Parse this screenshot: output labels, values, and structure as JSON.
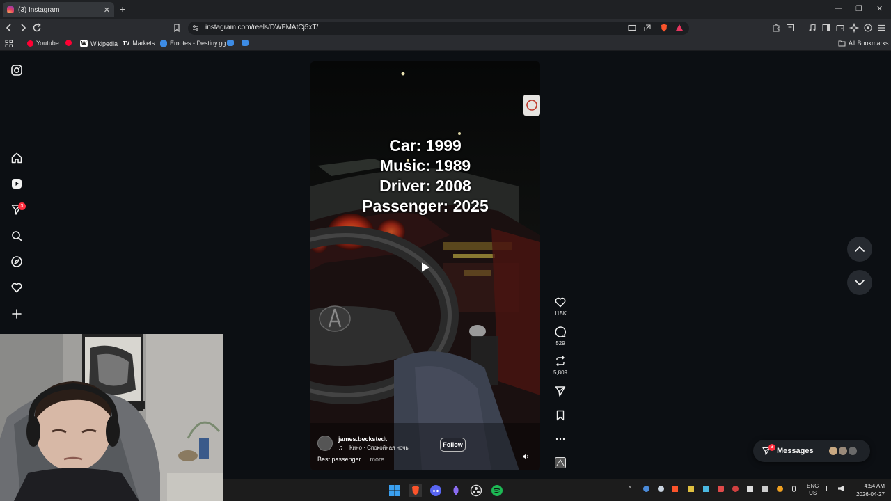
{
  "browser": {
    "tab_title": "(3) Instagram",
    "tab_close": "✕",
    "new_tab": "+",
    "url": "instagram.com/reels/DWFMAtCj5xT/",
    "window_controls": {
      "minimize": "—",
      "restore": "❐",
      "close": "✕"
    }
  },
  "bookmarks": {
    "items": [
      {
        "label": "Youtube",
        "icon": "youtube-icon",
        "color": "#ff0033"
      },
      {
        "label": "",
        "icon": "youtube-icon",
        "color": "#ff0033"
      },
      {
        "label": "Wikipedia",
        "icon": "wikipedia-icon",
        "color": "#ffffff"
      },
      {
        "label": "Markets",
        "icon": "tradingview-icon",
        "color": "#ffffff"
      },
      {
        "label": "Emotes - Destiny.gg",
        "icon": "destiny-icon",
        "color": "#3d8ce5"
      }
    ],
    "all_bookmarks": "All Bookmarks"
  },
  "sidebar": {
    "notification_count": "3",
    "items": [
      "instagram-logo",
      "home",
      "reels",
      "direct",
      "search",
      "explore",
      "notifications",
      "create"
    ]
  },
  "reel": {
    "overlay_lines": [
      "Car: 1999",
      "Music: 1989",
      "Driver: 2008",
      "Passenger: 2025"
    ],
    "username": "james.beckstedt",
    "audio": "Кино · Спокойная ночь",
    "follow_label": "Follow",
    "caption": "Best passenger ...",
    "more_label": "more"
  },
  "actions": {
    "likes": "115K",
    "comments": "529",
    "reposts": "5,809"
  },
  "messages": {
    "label": "Messages",
    "badge": "3"
  },
  "taskbar": {
    "language_top": "ENG",
    "language_bottom": "US",
    "time": "4:54 AM",
    "date": "2026-04-27"
  },
  "colors": {
    "accent": "#ff3040",
    "background": "#0c0f13"
  }
}
